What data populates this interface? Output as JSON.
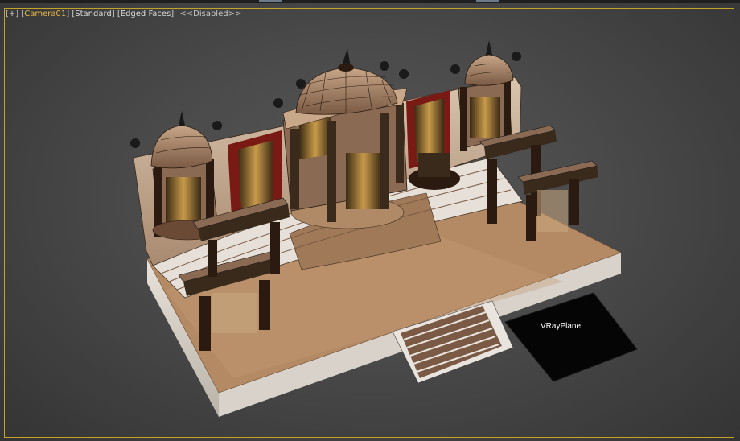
{
  "viewport_menu": {
    "plus": "+",
    "camera": "Camera01",
    "shading": "Standard",
    "edges": "Edged Faces",
    "disabled": "<<Disabled>>"
  },
  "scene": {
    "plane_label": "VRayPlane"
  },
  "colors": {
    "frame": "#c4a326",
    "camera_text": "#e8b84a",
    "platform": "#b48a64",
    "background": "#4a4a4a"
  }
}
